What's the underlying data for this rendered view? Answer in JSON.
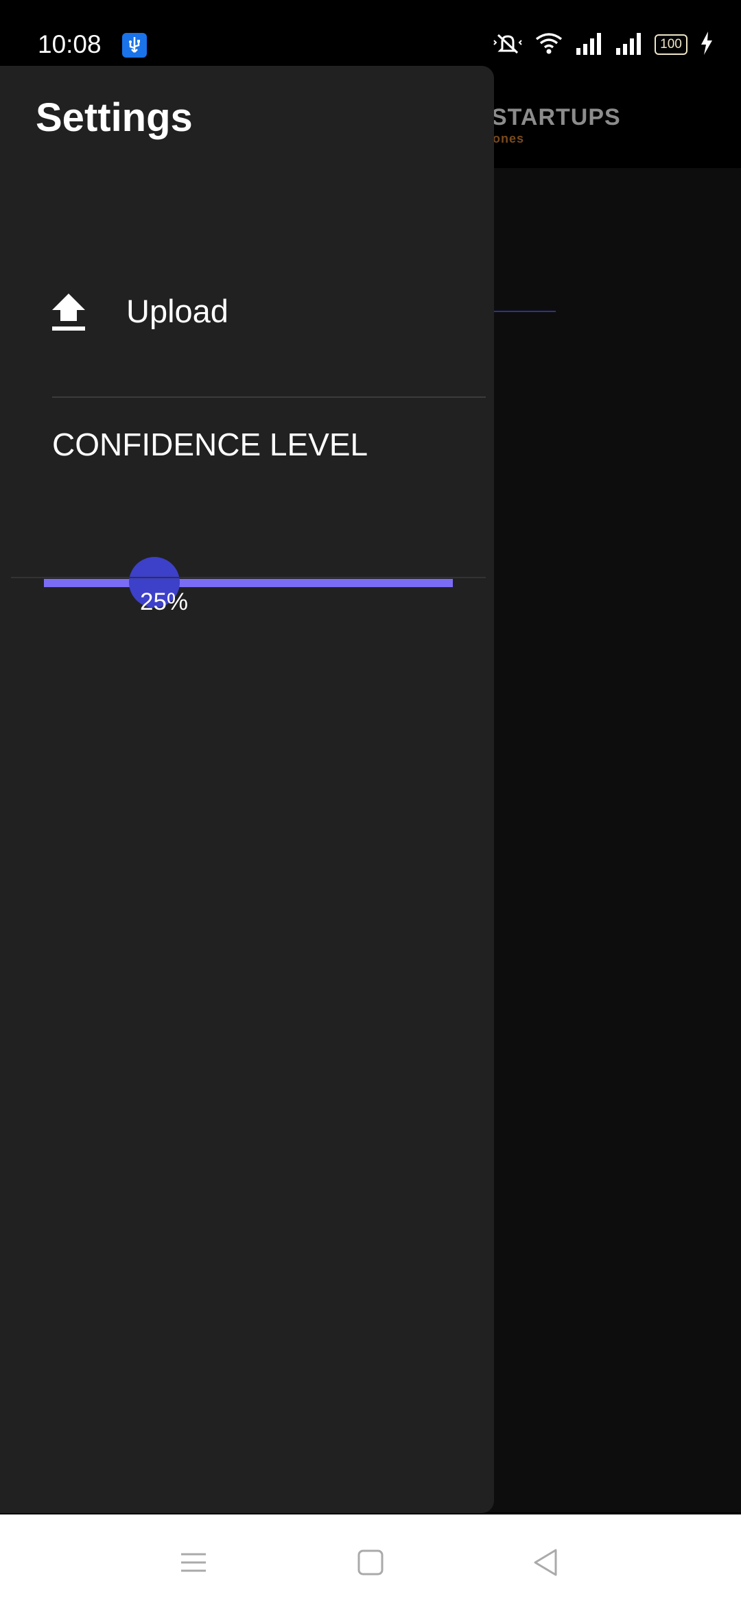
{
  "status_bar": {
    "time": "10:08",
    "battery": "100",
    "icons": [
      "usb-debug-icon",
      "mute-icon",
      "wifi-icon",
      "signal-icon",
      "signal-icon",
      "battery-icon",
      "charging-icon"
    ]
  },
  "background_app": {
    "brand_main": "STARTUPS",
    "brand_sub": "ones"
  },
  "drawer": {
    "title": "Settings",
    "upload_label": "Upload",
    "upload_icon": "upload-icon",
    "confidence_label": "CONFIDENCE LEVEL",
    "confidence_value": "25%",
    "confidence_fraction": 0.25
  },
  "nav_bar": {
    "icons": [
      "menu-icon",
      "home-icon",
      "back-icon"
    ]
  },
  "colors": {
    "accent_track": "#7b6cf6",
    "thumb": "#3d40c9",
    "drawer_bg": "#212121",
    "usb_badge": "#1a73e8"
  }
}
